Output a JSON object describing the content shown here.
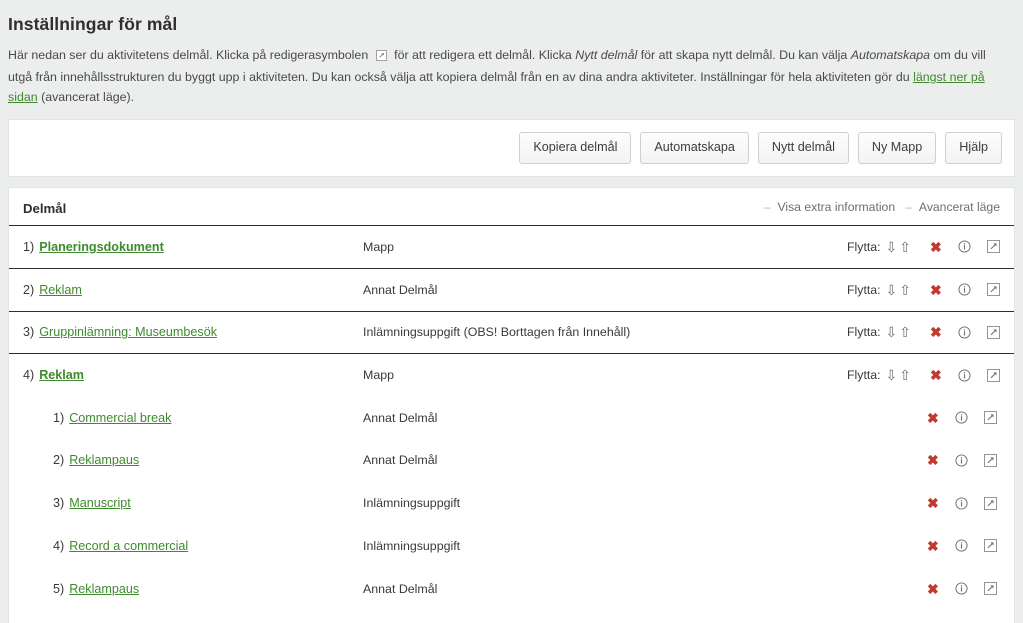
{
  "page": {
    "title": "Inställningar för mål",
    "description": {
      "part1": "Här nedan ser du aktivitetens delmål. Klicka på redigerasymbolen",
      "part2": "för att redigera ett delmål. Klicka",
      "italic1": "Nytt delmål",
      "part3": "för att skapa nytt delmål. Du kan välja",
      "italic2": "Automatskapa",
      "part4": "om du vill utgå från innehållsstrukturen du byggt upp i aktiviteten. Du kan också välja att kopiera delmål från en av dina andra aktiviteter. Inställningar för hela aktiviteten gör du",
      "link": "längst ner på sidan",
      "part5": "(avancerat läge)."
    }
  },
  "toolbar": {
    "buttons": [
      {
        "label": "Kopiera delmål",
        "name": "copy-goal-button"
      },
      {
        "label": "Automatskapa",
        "name": "auto-create-button"
      },
      {
        "label": "Nytt delmål",
        "name": "new-goal-button"
      },
      {
        "label": "Ny Mapp",
        "name": "new-folder-button"
      },
      {
        "label": "Hjälp",
        "name": "help-button"
      }
    ]
  },
  "list": {
    "header": {
      "title": "Delmål",
      "dash": "–",
      "show_extra_info": "Visa extra information",
      "advanced_mode": "Avancerat läge"
    },
    "move_label": "Flytta:",
    "icons": {
      "delete": "delete-icon",
      "info": "info-icon",
      "edit": "edit-icon",
      "move_down": "move-down-arrow-icon",
      "move_up": "move-up-arrow-icon"
    },
    "rows": [
      {
        "index": "1)",
        "name": "Planeringsdokument",
        "type": "Mapp",
        "level": "top",
        "bold": true,
        "move": true
      },
      {
        "index": "2)",
        "name": "Reklam",
        "type": "Annat Delmål",
        "level": "top",
        "bold": false,
        "move": true
      },
      {
        "index": "3)",
        "name": "Gruppinlämning: Museumbesök",
        "type": "Inlämningsuppgift (OBS! Borttagen från Innehåll)",
        "level": "top",
        "bold": false,
        "move": true
      },
      {
        "index": "4)",
        "name": "Reklam",
        "type": "Mapp",
        "level": "top",
        "bold": true,
        "move": true
      },
      {
        "index": "1)",
        "name": "Commercial break",
        "type": "Annat Delmål",
        "level": "child",
        "bold": false,
        "move": false
      },
      {
        "index": "2)",
        "name": "Reklampaus",
        "type": "Annat Delmål",
        "level": "child",
        "bold": false,
        "move": false
      },
      {
        "index": "3)",
        "name": "Manuscript",
        "type": "Inlämningsuppgift",
        "level": "child",
        "bold": false,
        "move": false
      },
      {
        "index": "4)",
        "name": "Record a commercial",
        "type": "Inlämningsuppgift",
        "level": "child",
        "bold": false,
        "move": false
      },
      {
        "index": "5)",
        "name": "Reklampaus",
        "type": "Annat Delmål",
        "level": "child",
        "bold": false,
        "move": false
      }
    ]
  },
  "colors": {
    "link_green": "#3f8a2e",
    "delete_red": "#c0392b",
    "background": "#eceded"
  }
}
